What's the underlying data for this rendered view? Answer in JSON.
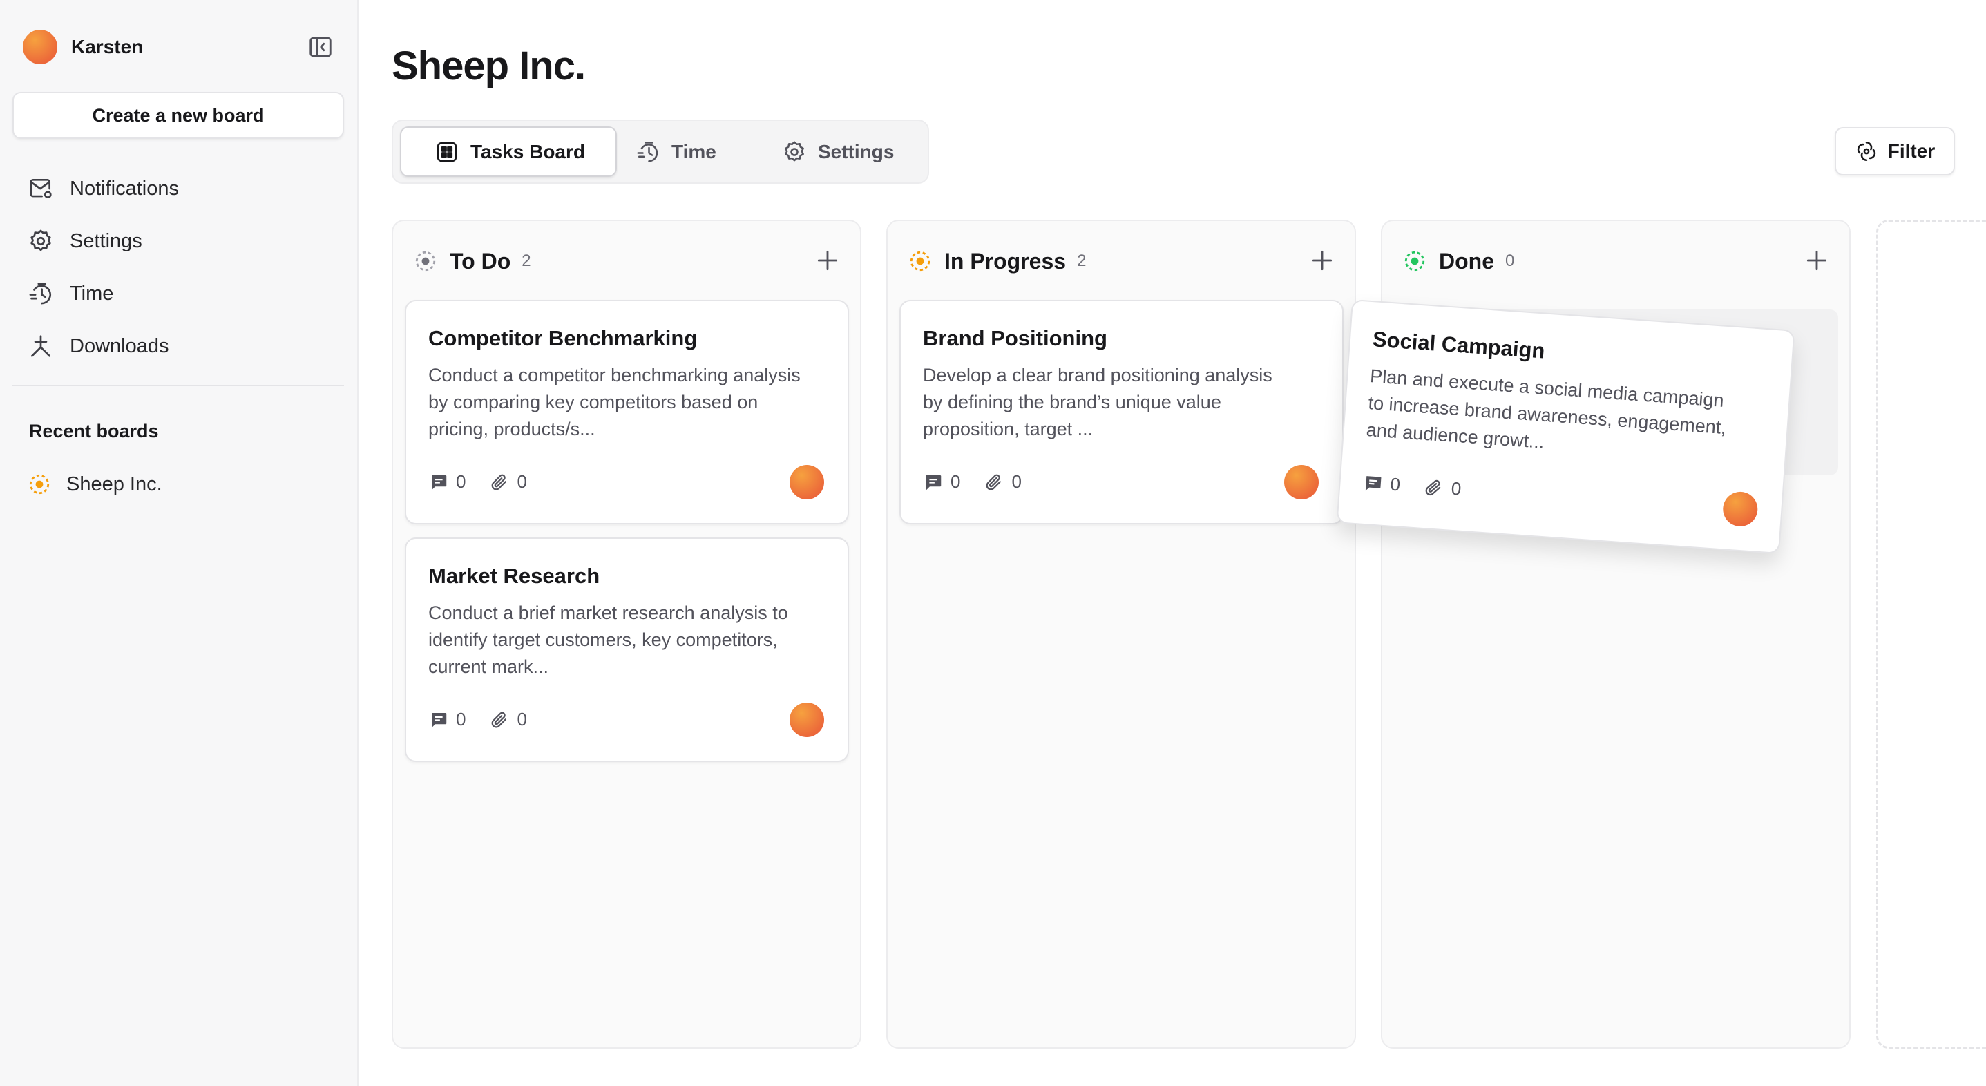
{
  "sidebar": {
    "user": {
      "name": "Karsten"
    },
    "create_board_label": "Create a new board",
    "nav": [
      {
        "label": "Notifications",
        "icon": "mail-icon"
      },
      {
        "label": "Settings",
        "icon": "gear-icon"
      },
      {
        "label": "Time",
        "icon": "timer-icon"
      },
      {
        "label": "Downloads",
        "icon": "download-icon"
      }
    ],
    "recent_title": "Recent boards",
    "recent_boards": [
      {
        "label": "Sheep Inc."
      }
    ]
  },
  "board": {
    "title": "Sheep Inc.",
    "tabs": [
      {
        "label": "Tasks Board",
        "active": true
      },
      {
        "label": "Time",
        "active": false
      },
      {
        "label": "Settings",
        "active": false
      }
    ],
    "filter_label": "Filter"
  },
  "columns": [
    {
      "title": "To Do",
      "count": "2",
      "status_color": "#71717a",
      "cards": [
        {
          "title": "Competitor Benchmarking",
          "description": "Conduct a competitor benchmarking analysis by comparing key competitors based on pricing, products/s...",
          "comments": "0",
          "attachments": "0"
        },
        {
          "title": "Market Research",
          "description": "Conduct a brief market research analysis to identify target customers, key competitors, current mark...",
          "comments": "0",
          "attachments": "0"
        }
      ]
    },
    {
      "title": "In Progress",
      "count": "2",
      "status_color": "#f59e0b",
      "cards": [
        {
          "title": "Brand Positioning",
          "description": "Develop a clear brand positioning analysis by defining the brand’s unique value proposition, target ...",
          "comments": "0",
          "attachments": "0"
        }
      ]
    },
    {
      "title": "Done",
      "count": "0",
      "status_color": "#22c55e",
      "cards": []
    }
  ],
  "dragging_card": {
    "title": "Social Campaign",
    "description": "Plan and execute a social media campaign to increase brand awareness, engagement, and audience growt...",
    "comments": "0",
    "attachments": "0"
  },
  "colors": {
    "accent": "#ec6a3a",
    "todo": "#71717a",
    "in_progress": "#f59e0b",
    "done": "#22c55e"
  }
}
